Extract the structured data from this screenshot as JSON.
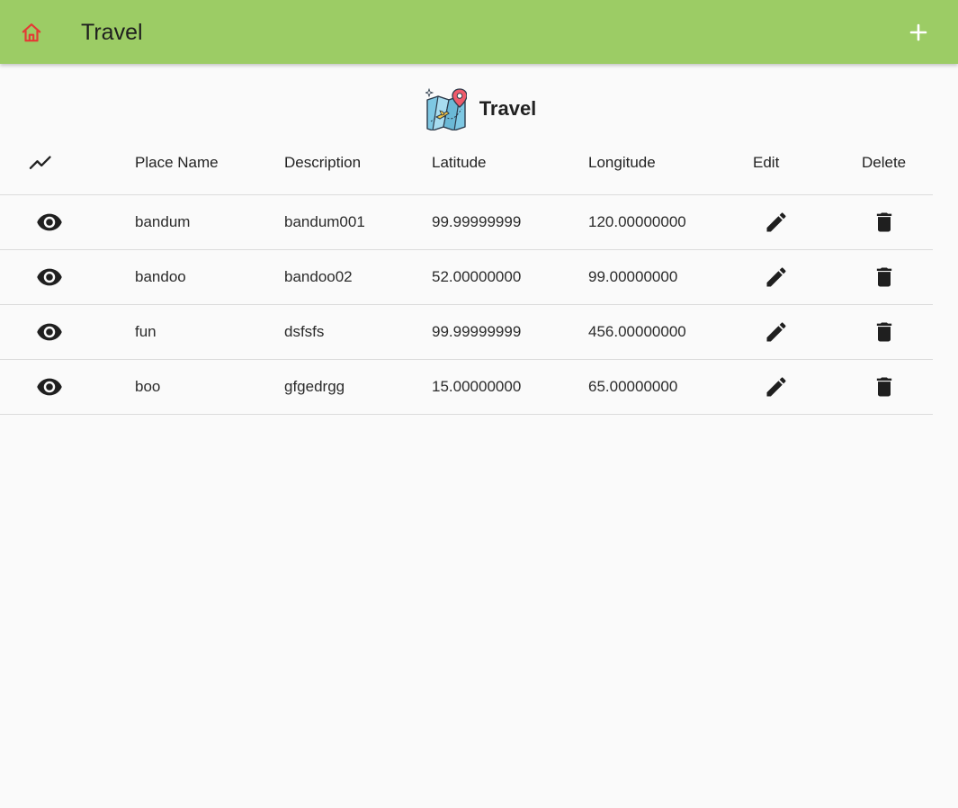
{
  "appbar": {
    "title": "Travel",
    "home_icon": "home-icon",
    "add_icon": "plus-icon",
    "background": "#9ccc65",
    "home_icon_color": "#e53935"
  },
  "header": {
    "title": "Travel",
    "logo_icon": "travel-map-icon"
  },
  "table": {
    "columns": {
      "trend_icon": "trending-icon",
      "place_name": "Place Name",
      "description": "Description",
      "latitude": "Latitude",
      "longitude": "Longitude",
      "edit": "Edit",
      "delete": "Delete"
    },
    "rows": [
      {
        "place_name": "bandum",
        "description": "bandum001",
        "latitude": "99.99999999",
        "longitude": "120.00000000"
      },
      {
        "place_name": "bandoo",
        "description": "bandoo02",
        "latitude": "52.00000000",
        "longitude": "99.00000000"
      },
      {
        "place_name": "fun",
        "description": "dsfsfs",
        "latitude": "99.99999999",
        "longitude": "456.00000000"
      },
      {
        "place_name": "boo",
        "description": "gfgedrgg",
        "latitude": "15.00000000",
        "longitude": "65.00000000"
      }
    ],
    "row_icons": {
      "view": "eye-icon",
      "edit": "pencil-icon",
      "delete": "trash-icon"
    }
  }
}
